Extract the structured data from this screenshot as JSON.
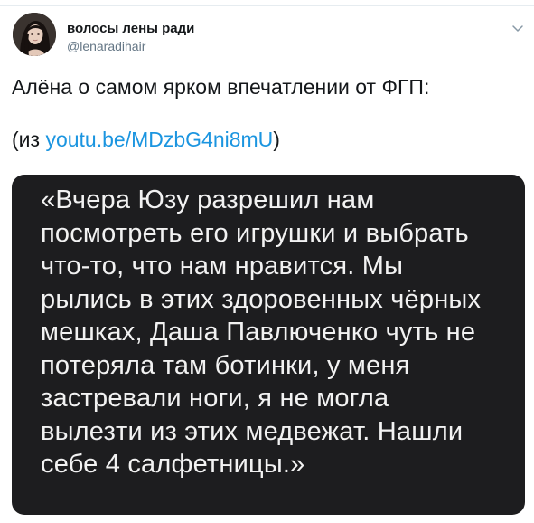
{
  "tweet": {
    "author_name": "волосы лены ради",
    "author_handle": "@lenaradihair",
    "text_line1": "Алёна о самом ярком впечатлении от ФГП:",
    "text_paren_open": "(из ",
    "link_text": "youtu.be/MDzbG4ni8mU",
    "text_paren_close": ")"
  },
  "media": {
    "quote_lines": [
      "«Вчера Юзу разрешил нам",
      "посмотреть его игрушки и выбрать",
      "что-то, что нам нравится. Мы",
      "рылись в этих здоровенных чёрных",
      "мешках, Даша Павлюченко чуть не",
      "потеряла там ботинки, у меня",
      "застревали ноги, я не могла",
      "вылезти из этих медвежат. Нашли",
      "себе 4 салфетницы.»"
    ]
  },
  "icons": {
    "avatar": "user-avatar",
    "menu": "chevron-down-icon"
  },
  "colors": {
    "link": "#1b95e0",
    "handle": "#657786",
    "media_bg": "#1d1d1f",
    "media_text": "#f2f2f2"
  }
}
